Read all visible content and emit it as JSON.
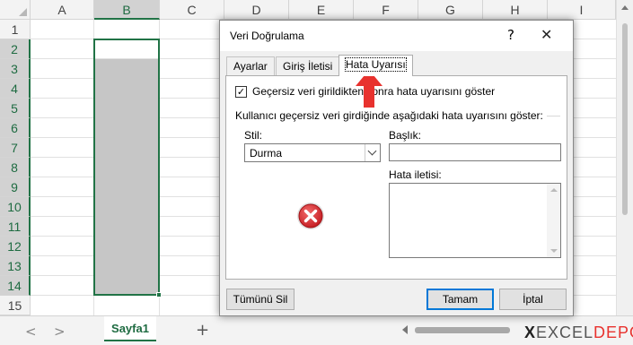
{
  "spreadsheet": {
    "columns": [
      "A",
      "B",
      "C",
      "D",
      "E",
      "F",
      "G",
      "H",
      "I"
    ],
    "rows": [
      "1",
      "2",
      "3",
      "4",
      "5",
      "6",
      "7",
      "8",
      "9",
      "10",
      "11",
      "12",
      "13",
      "14",
      "15"
    ],
    "selected_column": "B",
    "selected_rows": [
      "2",
      "3",
      "4",
      "5",
      "6",
      "7",
      "8",
      "9",
      "10",
      "11",
      "12",
      "13",
      "14"
    ]
  },
  "tabbar": {
    "sheet_tab": "Sayfa1",
    "add_sheet": "+",
    "nav_prev": "<",
    "nav_next": ">"
  },
  "logo": {
    "x": "X",
    "excel": "EXCEL",
    "depo": "DEPO"
  },
  "dialog": {
    "title": "Veri Doğrulama",
    "help": "?",
    "close": "✕",
    "tabs": [
      {
        "label": "Ayarlar",
        "active": false
      },
      {
        "label": "Giriş İletisi",
        "active": false
      },
      {
        "label": "Hata Uyarısı",
        "active": true
      }
    ],
    "show_alert_checkbox": {
      "checked": true,
      "check_glyph": "✓",
      "label": "Geçersiz veri girildikten sonra hata uyarısını göster"
    },
    "group_label": "Kullanıcı geçersiz veri girdiğinde aşağıdaki hata uyarısını göster:",
    "style_label": "Stil:",
    "style_value": "Durma",
    "title_label": "Başlık:",
    "title_value": "",
    "message_label": "Hata iletisi:",
    "message_value": "",
    "alert_icon": "stop-error-icon",
    "buttons": {
      "clear_all": "Tümünü Sil",
      "ok": "Tamam",
      "cancel": "İptal"
    }
  },
  "colors": {
    "excel_green": "#217346",
    "selection_fill": "#c6c6c6",
    "stop_red": "#d9262b",
    "annotation_red": "#e8322e",
    "default_button_border": "#0078d7"
  }
}
